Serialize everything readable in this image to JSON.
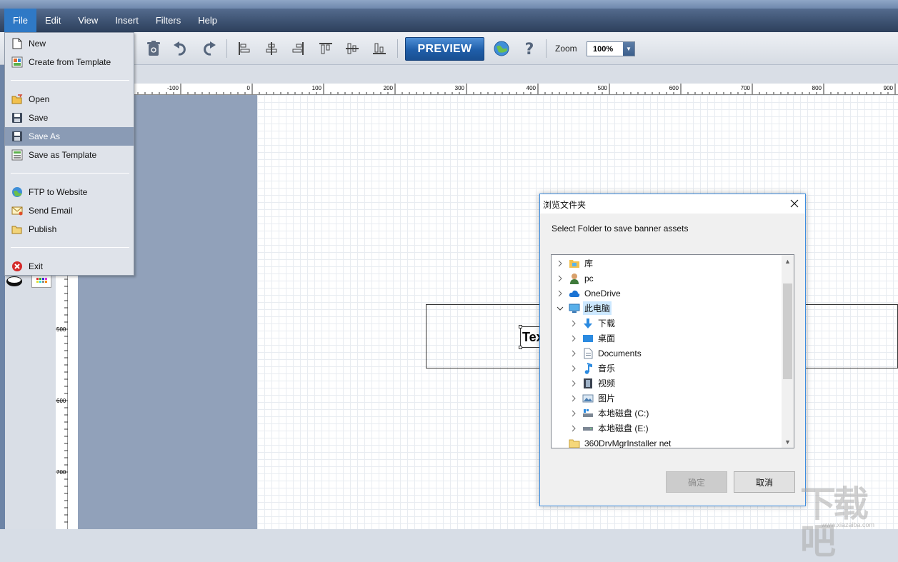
{
  "menubar": {
    "items": [
      "File",
      "Edit",
      "View",
      "Insert",
      "Filters",
      "Help"
    ]
  },
  "toolbar": {
    "preview_label": "PREVIEW",
    "zoom_label": "Zoom",
    "zoom_value": "100%"
  },
  "file_menu": {
    "items": [
      {
        "label": "New",
        "icon": "new-document-icon"
      },
      {
        "label": "Create from Template",
        "icon": "template-icon"
      },
      {
        "label": "Open",
        "icon": "open-folder-icon"
      },
      {
        "label": "Save",
        "icon": "save-icon"
      },
      {
        "label": "Save As",
        "icon": "save-as-icon",
        "highlighted": true
      },
      {
        "label": "Save as Template",
        "icon": "save-template-icon"
      },
      {
        "label": "FTP to Website",
        "icon": "ftp-icon"
      },
      {
        "label": "Send Email",
        "icon": "email-icon"
      },
      {
        "label": "Publish",
        "icon": "publish-folder-icon"
      },
      {
        "label": "Exit",
        "icon": "exit-icon"
      }
    ]
  },
  "ruler": {
    "h_ticks": [
      "-100",
      "0",
      "100",
      "200",
      "300",
      "400",
      "500",
      "600",
      "700",
      "800",
      "900"
    ],
    "v_ticks": [
      "500",
      "600",
      "700"
    ]
  },
  "canvas": {
    "text_element": "Text"
  },
  "dialog": {
    "title": "浏览文件夹",
    "instruction": "Select Folder to save banner assets",
    "tree": [
      {
        "label": "库",
        "icon": "library-icon",
        "level": 0,
        "expanded": false
      },
      {
        "label": "pc",
        "icon": "user-icon",
        "level": 0,
        "expanded": false
      },
      {
        "label": "OneDrive",
        "icon": "cloud-icon",
        "level": 0,
        "expanded": false
      },
      {
        "label": "此电脑",
        "icon": "computer-icon",
        "level": 0,
        "expanded": true,
        "selected": true
      },
      {
        "label": "下载",
        "icon": "download-icon",
        "level": 1,
        "expanded": false
      },
      {
        "label": "桌面",
        "icon": "desktop-icon",
        "level": 1,
        "expanded": false
      },
      {
        "label": "Documents",
        "icon": "documents-icon",
        "level": 1,
        "expanded": false
      },
      {
        "label": "音乐",
        "icon": "music-icon",
        "level": 1,
        "expanded": false
      },
      {
        "label": "视频",
        "icon": "video-icon",
        "level": 1,
        "expanded": false
      },
      {
        "label": "图片",
        "icon": "pictures-icon",
        "level": 1,
        "expanded": false
      },
      {
        "label": "本地磁盘 (C:)",
        "icon": "drive-c-icon",
        "level": 1,
        "expanded": false
      },
      {
        "label": "本地磁盘 (E:)",
        "icon": "drive-e-icon",
        "level": 1,
        "expanded": false
      },
      {
        "label": "360DrvMgrInstaller net",
        "icon": "folder-icon",
        "level": 0,
        "expanded": false
      }
    ],
    "ok_label": "确定",
    "cancel_label": "取消"
  }
}
